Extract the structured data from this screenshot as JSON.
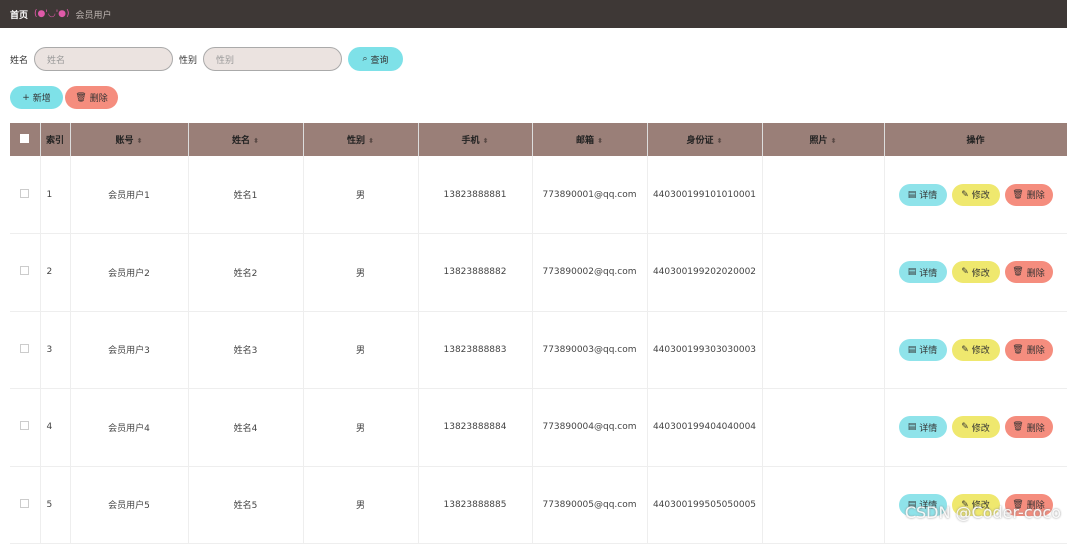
{
  "breadcrumb": {
    "home": "首页",
    "sep": "(●'◡'●)",
    "current": "会员用户"
  },
  "search": {
    "name_label": "姓名",
    "name_placeholder": "姓名",
    "gender_label": "性别",
    "gender_placeholder": "性别",
    "query_label": "查询"
  },
  "toolbar": {
    "add_label": "新增",
    "delete_label": "删除"
  },
  "table": {
    "headers": [
      "索引",
      "账号",
      "姓名",
      "性别",
      "手机",
      "邮箱",
      "身份证",
      "照片",
      "操作"
    ],
    "rows": [
      {
        "index": "1",
        "account": "会员用户1",
        "name": "姓名1",
        "gender": "男",
        "phone": "13823888881",
        "email": "773890001@qq.com",
        "idcard": "440300199101010001"
      },
      {
        "index": "2",
        "account": "会员用户2",
        "name": "姓名2",
        "gender": "男",
        "phone": "13823888882",
        "email": "773890002@qq.com",
        "idcard": "440300199202020002"
      },
      {
        "index": "3",
        "account": "会员用户3",
        "name": "姓名3",
        "gender": "男",
        "phone": "13823888883",
        "email": "773890003@qq.com",
        "idcard": "440300199303030003"
      },
      {
        "index": "4",
        "account": "会员用户4",
        "name": "姓名4",
        "gender": "男",
        "phone": "13823888884",
        "email": "773890004@qq.com",
        "idcard": "440300199404040004"
      },
      {
        "index": "5",
        "account": "会员用户5",
        "name": "姓名5",
        "gender": "男",
        "phone": "13823888885",
        "email": "773890005@qq.com",
        "idcard": "440300199505050005"
      }
    ],
    "op_labels": {
      "detail": "详情",
      "edit": "修改",
      "delete": "删除"
    }
  },
  "watermark": "CSDN @Coder-coco",
  "colors": {
    "topbar": "#3e3836",
    "header": "#9a7f78",
    "cyan": "#7ee1e8",
    "yellow": "#efe86e",
    "salmon": "#f58d7e"
  }
}
